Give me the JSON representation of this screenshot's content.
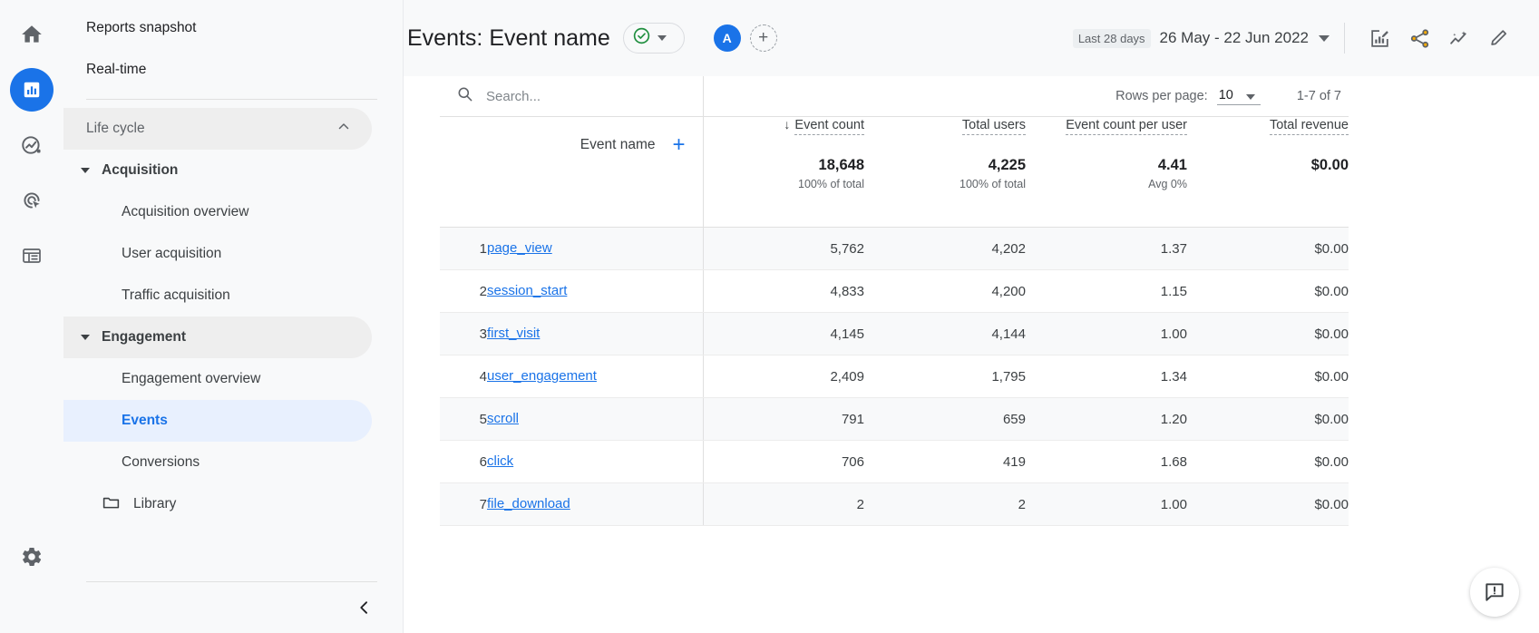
{
  "rail": {
    "items": [
      {
        "name": "home-icon",
        "label": "Home",
        "active": false
      },
      {
        "name": "reports-icon",
        "label": "Reports",
        "active": true
      },
      {
        "name": "explore-icon",
        "label": "Explore",
        "active": false
      },
      {
        "name": "advertising-icon",
        "label": "Advertising",
        "active": false
      },
      {
        "name": "configure-icon",
        "label": "Configure",
        "active": false
      }
    ],
    "settings_label": "Admin"
  },
  "sidebar": {
    "top_items": [
      "Reports snapshot",
      "Real-time"
    ],
    "section_label": "Life cycle",
    "groups": [
      {
        "label": "Acquisition",
        "children": [
          "Acquisition overview",
          "User acquisition",
          "Traffic acquisition"
        ]
      },
      {
        "label": "Engagement",
        "children": [
          "Engagement overview",
          "Events",
          "Conversions"
        ]
      }
    ],
    "selected_child": "Events",
    "library_label": "Library",
    "collapse_label": "Collapse navigation"
  },
  "header": {
    "title": "Events: Event name",
    "status_icon": "check-circle-icon",
    "avatar_letter": "A",
    "add_comparison_label": "+",
    "date_badge": "Last 28 days",
    "date_range": "26 May - 22 Jun 2022",
    "actions": [
      "edit-comparison-icon",
      "share-icon",
      "insights-icon",
      "customize-icon"
    ]
  },
  "table": {
    "search_placeholder": "Search...",
    "rows_per_page_label": "Rows per page:",
    "rows_per_page_value": "10",
    "pagination": "1-7 of 7",
    "dimension_header": "Event name",
    "add_dimension_label": "+",
    "sort_indicator": "↓",
    "metrics": [
      {
        "label": "Event count",
        "sorted": true,
        "total": "18,648",
        "subtotal": "100% of total"
      },
      {
        "label": "Total users",
        "sorted": false,
        "total": "4,225",
        "subtotal": "100% of total"
      },
      {
        "label": "Event count per user",
        "sorted": false,
        "total": "4.41",
        "subtotal": "Avg 0%"
      },
      {
        "label": "Total revenue",
        "sorted": false,
        "total": "$0.00",
        "subtotal": ""
      }
    ],
    "rows": [
      {
        "index": "1",
        "name": "page_view",
        "event_count": "5,762",
        "total_users": "4,202",
        "per_user": "1.37",
        "revenue": "$0.00"
      },
      {
        "index": "2",
        "name": "session_start",
        "event_count": "4,833",
        "total_users": "4,200",
        "per_user": "1.15",
        "revenue": "$0.00"
      },
      {
        "index": "3",
        "name": "first_visit",
        "event_count": "4,145",
        "total_users": "4,144",
        "per_user": "1.00",
        "revenue": "$0.00"
      },
      {
        "index": "4",
        "name": "user_engagement",
        "event_count": "2,409",
        "total_users": "1,795",
        "per_user": "1.34",
        "revenue": "$0.00"
      },
      {
        "index": "5",
        "name": "scroll",
        "event_count": "791",
        "total_users": "659",
        "per_user": "1.20",
        "revenue": "$0.00"
      },
      {
        "index": "6",
        "name": "click",
        "event_count": "706",
        "total_users": "419",
        "per_user": "1.68",
        "revenue": "$0.00"
      },
      {
        "index": "7",
        "name": "file_download",
        "event_count": "2",
        "total_users": "2",
        "per_user": "1.00",
        "revenue": "$0.00"
      }
    ]
  },
  "feedback": {
    "label": "Send feedback",
    "icon": "feedback-icon"
  },
  "colors": {
    "accent": "#1a73e8",
    "success": "#1e8e3e",
    "text": "#3c4043",
    "muted": "#5f6368",
    "bg": "#f8f9fa"
  }
}
